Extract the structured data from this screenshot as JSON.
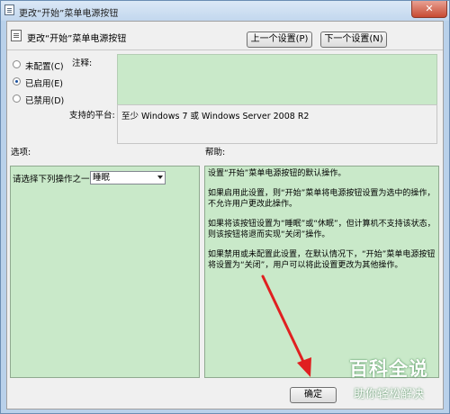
{
  "window": {
    "title": "更改“开始”菜单电源按钮",
    "close_label": "✕"
  },
  "header": {
    "setting_name": "更改“开始”菜单电源按钮",
    "prev_button": "上一个设置(P)",
    "next_button": "下一个设置(N)"
  },
  "state": {
    "options": [
      {
        "label": "未配置(C)",
        "checked": false
      },
      {
        "label": "已启用(E)",
        "checked": true
      },
      {
        "label": "已禁用(D)",
        "checked": false
      }
    ]
  },
  "comment": {
    "label": "注释:",
    "value": ""
  },
  "platform": {
    "label": "支持的平台:",
    "value": "至少 Windows 7 或 Windows Server 2008 R2"
  },
  "options_section": {
    "label": "选项:",
    "prompt": "请选择下列操作之一",
    "selected_value": "睡眠"
  },
  "help_section": {
    "label": "帮助:",
    "paragraphs": [
      "设置“开始”菜单电源按钮的默认操作。",
      "如果启用此设置，则“开始”菜单将电源按钮设置为选中的操作，不允许用户更改此操作。",
      "如果将该按钮设置为“睡眠”或“休眠”，但计算机不支持该状态，则该按钮将退而实现“关闭”操作。",
      "如果禁用或未配置此设置，在默认情况下，“开始”菜单电源按钮将设置为“关闭”，用户可以将此设置更改为其他操作。"
    ]
  },
  "footer": {
    "ok_button": "确定"
  },
  "annotation": {
    "arrow_color": "#e02020"
  },
  "watermark": {
    "title": "百科全说",
    "subtitle": "助你轻松解决"
  },
  "colors": {
    "pane_green": "#c9e9c9",
    "window_frame": "#b9d1ea"
  }
}
